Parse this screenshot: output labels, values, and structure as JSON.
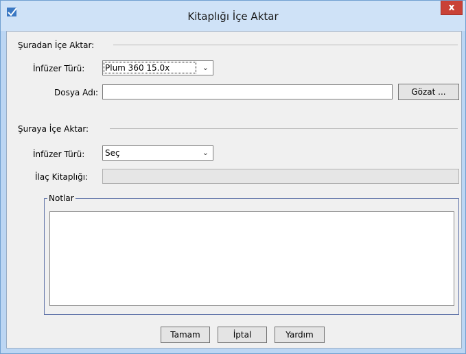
{
  "window": {
    "title": "Kitaplığı İçe Aktar",
    "close_label": "x"
  },
  "from_section": {
    "heading": "Şuradan İçe Aktar:",
    "infuser_label": "İnfüzer Türü:",
    "infuser_value": "Plum 360 15.0x",
    "file_label": "Dosya Adı:",
    "file_value": "",
    "browse_label": "Gözat ..."
  },
  "to_section": {
    "heading": "Şuraya İçe Aktar:",
    "infuser_label": "İnfüzer Türü:",
    "infuser_value": "Seç",
    "library_label": "İlaç Kitaplığı:",
    "library_value": ""
  },
  "notes": {
    "label": "Notlar",
    "value": ""
  },
  "buttons": {
    "ok": "Tamam",
    "cancel": "İptal",
    "help": "Yardım"
  },
  "icons": {
    "app": "app-logo-icon",
    "dropdown": "chevron-down-icon"
  },
  "colors": {
    "close_bg": "#c94237",
    "frame": "#bcd6f3",
    "client_bg": "#f0f0f0"
  }
}
